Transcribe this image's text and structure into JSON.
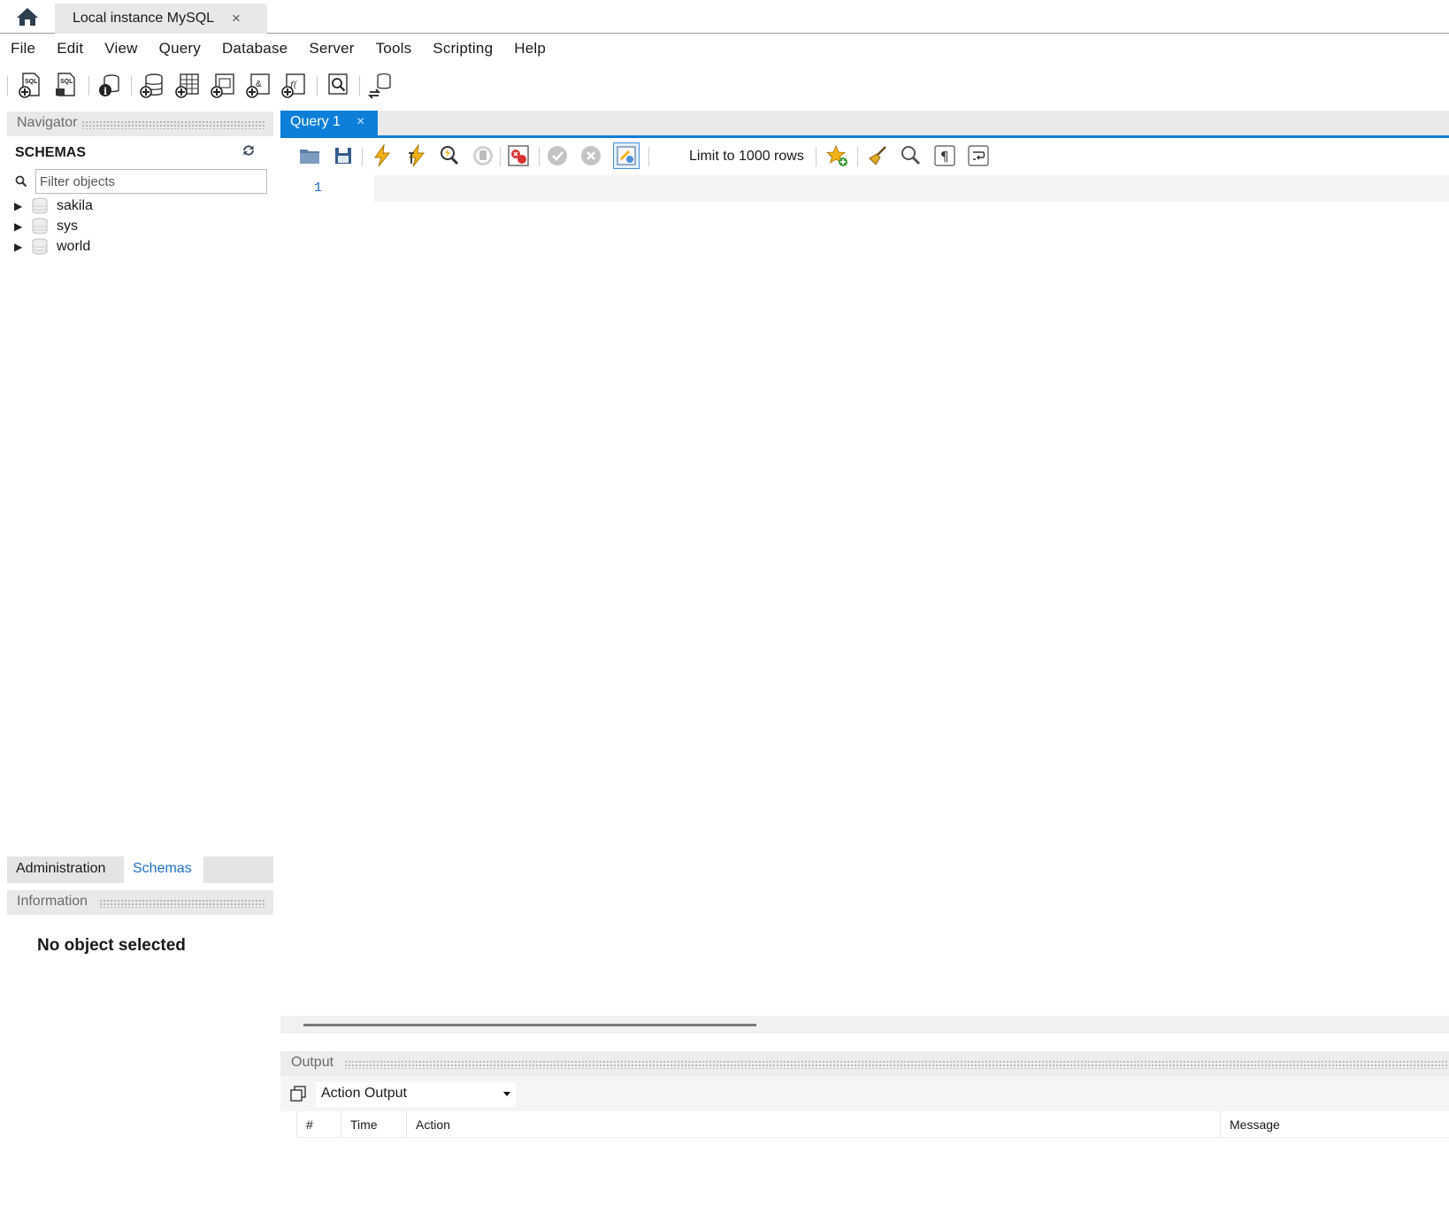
{
  "connection_tab": {
    "label": "Local instance MySQL",
    "close": "×"
  },
  "menu": [
    "File",
    "Edit",
    "View",
    "Query",
    "Database",
    "Server",
    "Tools",
    "Scripting",
    "Help"
  ],
  "navigator": {
    "header": "Navigator",
    "schemas_title": "SCHEMAS",
    "filter_placeholder": "Filter objects",
    "schemas": [
      "sakila",
      "sys",
      "world"
    ]
  },
  "sidebar_tabs": {
    "administration": "Administration",
    "schemas": "Schemas",
    "active": "schemas"
  },
  "information": {
    "header": "Information",
    "empty_text": "No object selected"
  },
  "editor": {
    "tab_label": "Query 1",
    "tab_close": "×",
    "limit_rows": "Limit to 1000 rows",
    "line_number": "1"
  },
  "output": {
    "header": "Output",
    "mode": "Action Output",
    "columns": [
      "#",
      "Time",
      "Action",
      "Message"
    ]
  },
  "colors": {
    "accent": "#0d7fd8",
    "link": "#1e6fc7"
  }
}
